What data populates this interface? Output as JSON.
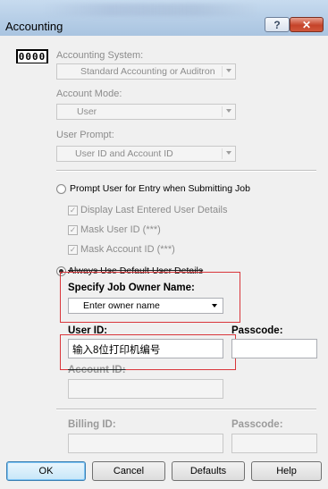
{
  "window": {
    "title": "Accounting",
    "help_glyph": "?",
    "close_glyph": "✕"
  },
  "icon_text": "0000",
  "accounting_system": {
    "label": "Accounting System:",
    "value": "Standard Accounting or Auditron"
  },
  "account_mode": {
    "label": "Account Mode:",
    "value": "User"
  },
  "user_prompt": {
    "label": "User Prompt:",
    "value": "User ID and Account ID"
  },
  "prompt_option": {
    "label": "Prompt User for Entry when Submitting Job",
    "checked": false
  },
  "checkboxes": [
    {
      "label": "Display Last Entered User Details",
      "checked": true
    },
    {
      "label": "Mask User ID (***)",
      "checked": true
    },
    {
      "label": "Mask Account ID (***)",
      "checked": true
    }
  ],
  "default_option": {
    "label": "Always Use Default User Details",
    "checked": true
  },
  "owner_name": {
    "label": "Specify Job Owner Name:",
    "value": "Enter owner name"
  },
  "user_id": {
    "label": "User ID:",
    "value": "输入8位打印机编号"
  },
  "passcode_1": {
    "label": "Passcode:",
    "value": ""
  },
  "account_id": {
    "label": "Account ID:",
    "value": ""
  },
  "billing_id": {
    "label": "Billing ID:",
    "value": ""
  },
  "passcode_2": {
    "label": "Passcode:",
    "value": ""
  },
  "buttons": {
    "ok": "OK",
    "cancel": "Cancel",
    "defaults": "Defaults",
    "help": "Help"
  },
  "colors": {
    "highlight_border": "#d9363b",
    "titlebar": "#b9d0e8"
  }
}
